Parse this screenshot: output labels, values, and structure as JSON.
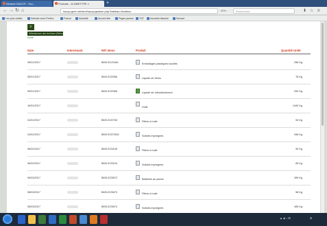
{
  "browser": {
    "tabs": [
      {
        "label": "Intranet HACCP - Scc..."
      },
      {
        "label": "Produits - ZLOBETYPE ×"
      }
    ],
    "new_tab": "+",
    "url": "haccp.gme.net/sim/haccp/gestion.php?tableau=livraison",
    "search_placeholder": "Rechercher",
    "zoom": "90%",
    "bookmarks": [
      "Les plus visités",
      "Débuter avec Firefox",
      "France",
      "Actualité",
      "Accueil site",
      "Pages jaunes",
      "TNT",
      "Nouvelle Attache",
      "Suivant"
    ]
  },
  "page": {
    "menu_icon": "≡",
    "return_button": "Sélectionner des Archives (Retour) ici",
    "tag": "Fiche",
    "headers": {
      "date": "Date",
      "intervenant": "Intervenant",
      "bon": "Réf. Bons",
      "produit": "Produit",
      "quantite": "Quantité Unité"
    },
    "rows": [
      {
        "date": "05/01/2017",
        "bon": "BMG-E1234IA",
        "produit": "Emballages plastiques souillés",
        "qte": "256 Kg"
      },
      {
        "date": "05/01/2017",
        "bon": "BMG-E22956",
        "produit": "Liquide de freins",
        "qte": "78 Kg"
      },
      {
        "date": "05/01/2017",
        "bon": "BMG-E22966",
        "produit": "Liquide de refroidissement",
        "qte": "252 Kg"
      },
      {
        "date": "16/01/2017",
        "bon": "",
        "produit": "Huile",
        "qte": "1440 Kg"
      },
      {
        "date": "24/01/2017",
        "bon": "BMG-E22763",
        "produit": "Filtres à huile",
        "qte": "54 Kg"
      },
      {
        "date": "24/01/2017",
        "bon": "BMG-E22762A",
        "produit": "Solides imprégnés",
        "qte": "346 Kg"
      },
      {
        "date": "06/02/2017",
        "bon": "BMG-E23105",
        "produit": "Filtres à huile",
        "qte": "90 Kg"
      },
      {
        "date": "06/02/2017",
        "bon": "BMG-E23104",
        "produit": "Solides imprégnés",
        "qte": "83 Kg"
      },
      {
        "date": "06/03/2017",
        "bon": "BMG-E23672",
        "produit": "Batteries au plomb",
        "qte": "395 Kg"
      },
      {
        "date": "08/03/2017",
        "bon": "BMG-E23673",
        "produit": "Filtres à huile",
        "qte": "58 Kg"
      },
      {
        "date": "08/03/2017",
        "bon": "BMG-E23674",
        "produit": "Solides imprégnés",
        "qte": "455 Kg"
      }
    ]
  },
  "colors": {
    "header_red": "#d23b1a",
    "button_dark": "#1c3810",
    "tab_blue": "#2f4f7c"
  }
}
